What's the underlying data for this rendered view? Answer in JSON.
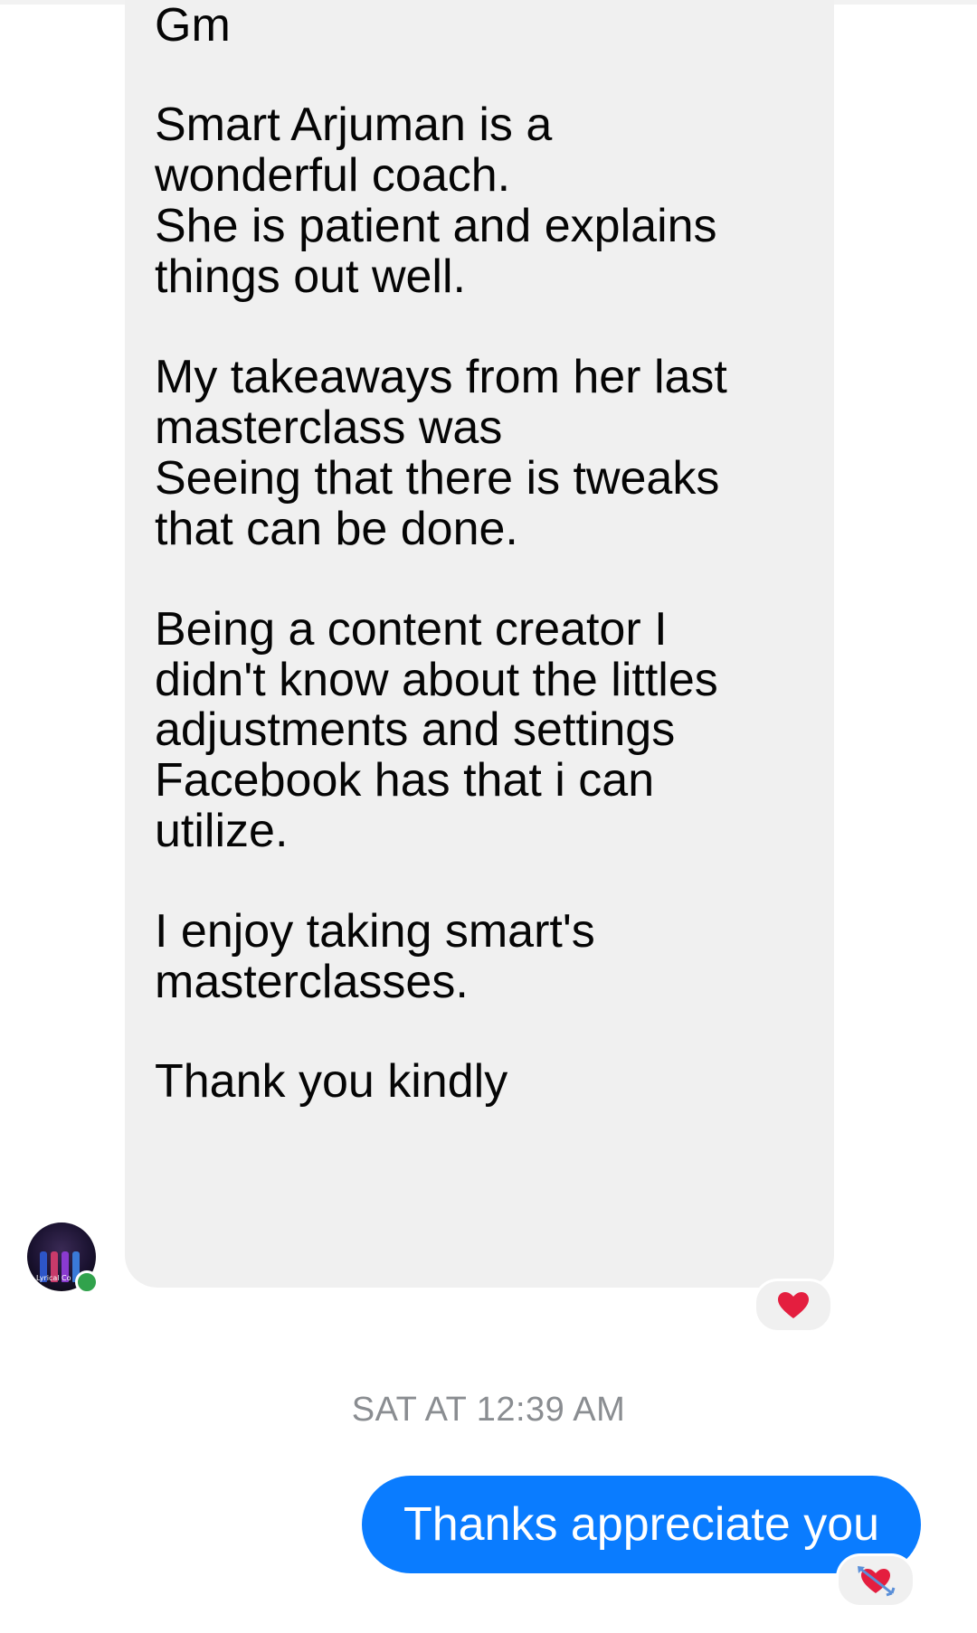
{
  "conversation": {
    "incoming_message": {
      "lines": [
        "Gm",
        "Smart Arjuman is a",
        "wonderful coach.",
        "She is patient and explains",
        "things out well.",
        "My takeaways from her last",
        "masterclass was",
        "Seeing that there is tweaks",
        "that can be done.",
        "Being a content creator I",
        "didn't know about the littles",
        "adjustments and settings",
        "Facebook has that i can",
        "utilize.",
        "I enjoy taking smart's",
        "masterclasses.",
        "Thank you kindly"
      ],
      "reaction": "heart",
      "sender_avatar_text": "Lyrical Co",
      "sender_online": true
    },
    "timestamp": "SAT AT 12:39 AM",
    "outgoing_message": {
      "text": "Thanks appreciate you",
      "reaction": "heart-with-arrow"
    }
  },
  "colors": {
    "incoming_bubble": "#f0f0f0",
    "outgoing_bubble": "#0a7cff",
    "timestamp": "#8a8d91",
    "online": "#31a24c",
    "heart": "#e41e3f"
  }
}
